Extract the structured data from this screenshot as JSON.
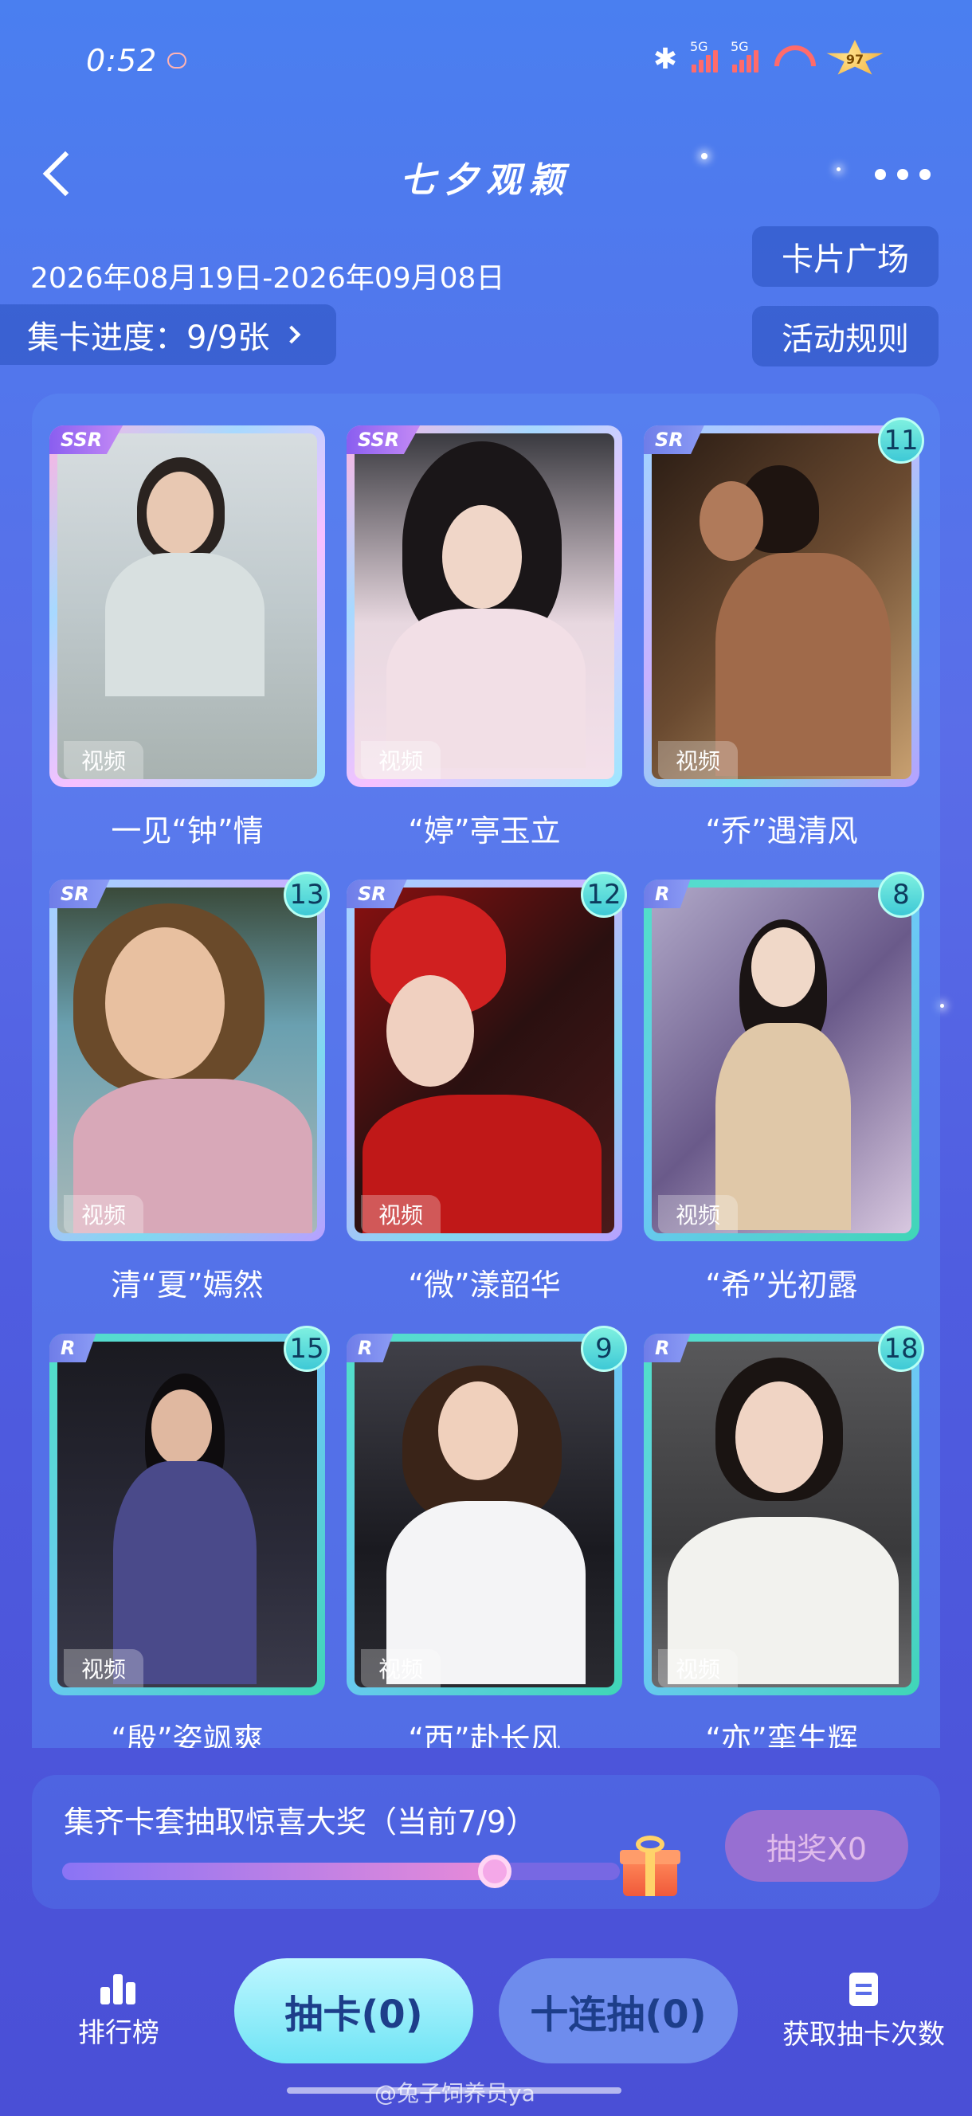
{
  "status_bar": {
    "time": "0:52",
    "network_1": "5G",
    "network_2": "5G",
    "battery": "97"
  },
  "header": {
    "title": "七夕观颖",
    "back_icon": "chevron-left-icon",
    "more_icon": "more-horizontal-icon"
  },
  "event": {
    "date_range": "2026年08月19日-2026年09月08日",
    "progress_label": "集卡进度：9/9张",
    "card_plaza": "卡片广场",
    "activity_rules": "活动规则"
  },
  "cards": [
    {
      "rarity": "SSR",
      "tag": "视频",
      "name": "一见“钟”情",
      "count": ""
    },
    {
      "rarity": "SSR",
      "tag": "视频",
      "name": "“婷”亭玉立",
      "count": ""
    },
    {
      "rarity": "SR",
      "tag": "视频",
      "name": "“乔”遇清风",
      "count": "11"
    },
    {
      "rarity": "SR",
      "tag": "视频",
      "name": "清“夏”嫣然",
      "count": "13"
    },
    {
      "rarity": "SR",
      "tag": "视频",
      "name": "“微”漾韶华",
      "count": "12"
    },
    {
      "rarity": "R",
      "tag": "视频",
      "name": "“希”光初露",
      "count": "8"
    },
    {
      "rarity": "R",
      "tag": "视频",
      "name": "“殷”姿飒爽",
      "count": "15"
    },
    {
      "rarity": "R",
      "tag": "视频",
      "name": "“西”赴长风",
      "count": "9"
    },
    {
      "rarity": "R",
      "tag": "视频",
      "name": "“亦”挛生辉",
      "count": "18"
    }
  ],
  "prize": {
    "text": "集齐卡套抽取惊喜大奖（当前7/9）",
    "progress_fraction": 0.78,
    "lottery_button": "抽奖X0",
    "gift_icon": "gift-icon"
  },
  "bottom_bar": {
    "rank_label": "排行榜",
    "draw_button": "抽卡(0)",
    "ten_draw_button": "十连抽(0)",
    "get_times_label": "获取抽卡次数",
    "watermark": "@兔子饲养员ya"
  },
  "colors": {
    "accent_cyan": "#6fe4f5",
    "background_blue": "#4f5de0"
  }
}
